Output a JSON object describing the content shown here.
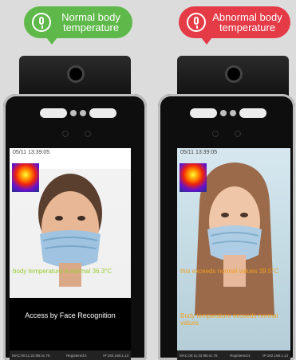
{
  "left_panel": {
    "bubble_text": "Normal body temperature",
    "bubble_color": "#5fb94a",
    "timestamp": "05/11 13:39:05",
    "status_text": "body temperature is normal 36.3°C",
    "status_color": "#9acd32",
    "access_text": "Access by Face Recognition",
    "footer": {
      "mac": "MAC:00:11:22:0B:4c:78",
      "registered": "Registered:4",
      "ip": "IP:192.168.1.13"
    }
  },
  "right_panel": {
    "bubble_text": "Abnormal body temperature",
    "bubble_color": "#e53b47",
    "timestamp": "05/11 13:39:05",
    "status_text": "this exceeds normal values 39.5°C",
    "status_color": "#f0a020",
    "alert_text": "Body temperature exceeds normal values",
    "footer": {
      "mac": "MAC:00:11:22:0B:4c:78",
      "registered": "Registered:4",
      "ip": "IP:192.168.1.13"
    }
  },
  "icons": [
    "microphone-icon",
    "camera-lens-icon",
    "thermal-image-icon"
  ]
}
